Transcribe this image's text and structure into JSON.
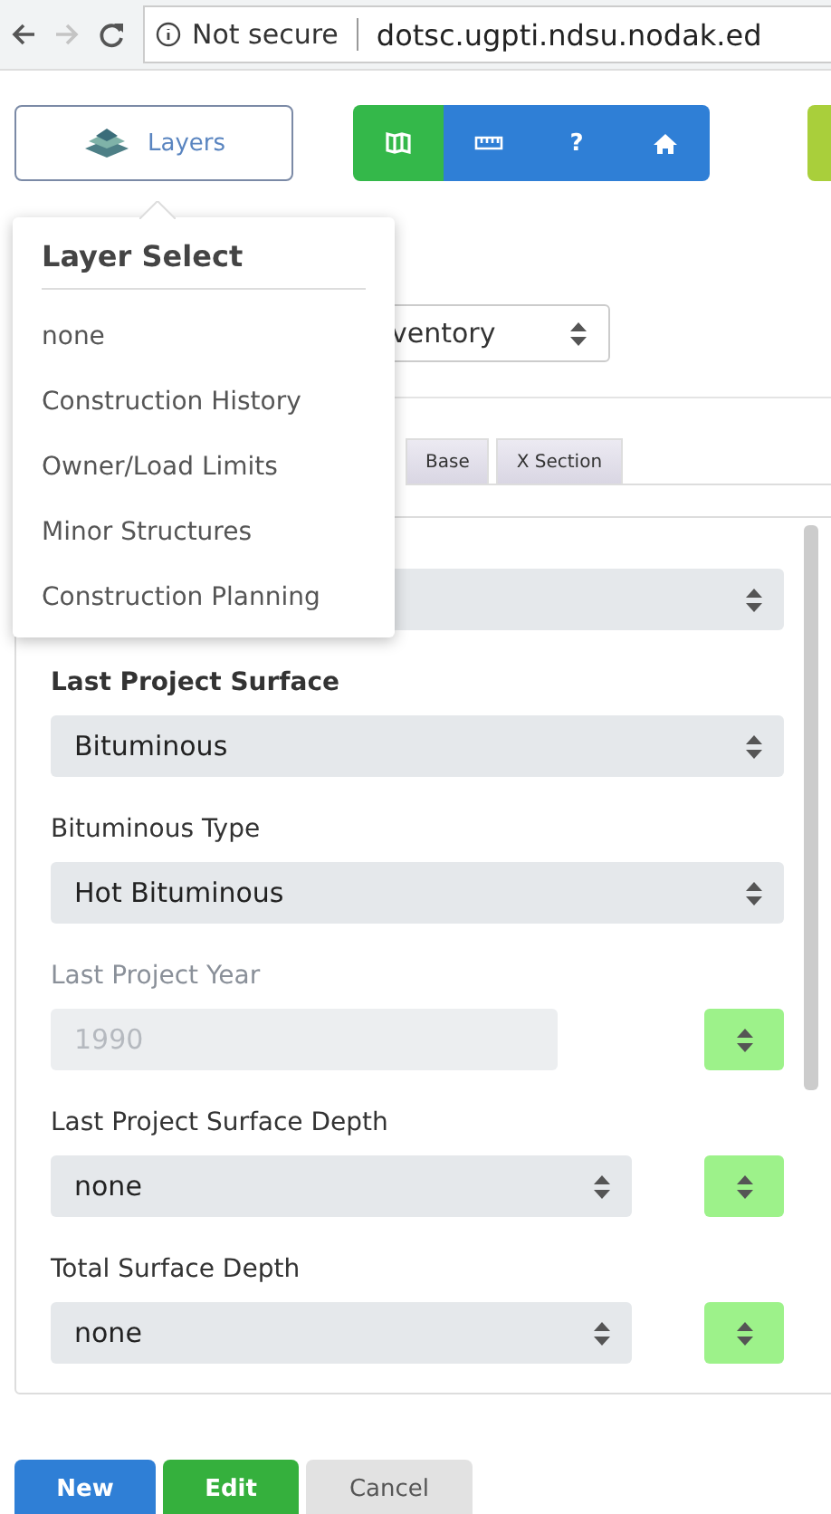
{
  "browser": {
    "back": {
      "disabled": false
    },
    "forward": {
      "disabled": true
    },
    "security": "Not secure",
    "url": "dotsc.ugpti.ndsu.nodak.ed"
  },
  "toolbar": {
    "layers_button": "Layers",
    "tools": [
      {
        "kind": "map",
        "selected": true
      },
      {
        "kind": "ruler",
        "selected": false
      },
      {
        "kind": "help",
        "label": "?",
        "selected": false
      },
      {
        "kind": "home",
        "selected": false
      }
    ]
  },
  "layer_menu": {
    "title": "Layer Select",
    "items": [
      "none",
      "Construction History",
      "Owner/Load Limits",
      "Minor Structures",
      "Construction Planning"
    ]
  },
  "view_select": {
    "value": "ventory"
  },
  "tabs": [
    {
      "label": "Base",
      "selected": false
    },
    {
      "label": "X Section",
      "selected": false
    }
  ],
  "fields": [
    {
      "kind": "select"
    },
    {
      "kind": "select",
      "label": "Last Project Surface",
      "value": "Bituminous",
      "disabled": false,
      "bold": true
    },
    {
      "kind": "select",
      "label": "Bituminous Type",
      "value": "Hot Bituminous",
      "disabled": false,
      "bold": false
    },
    {
      "kind": "input-side",
      "label": "Last Project Year",
      "value": "1990",
      "disabled": true,
      "bold": false
    },
    {
      "kind": "select-side",
      "label": "Last Project Surface Depth",
      "value": "none",
      "disabled": false,
      "bold": false
    },
    {
      "kind": "select-side",
      "label": "Total Surface Depth",
      "value": "none",
      "disabled": false,
      "bold": false
    }
  ],
  "buttons": [
    {
      "kind": "primary",
      "label": "New"
    },
    {
      "kind": "success",
      "label": "Edit"
    },
    {
      "kind": "default",
      "label": "Cancel"
    }
  ]
}
